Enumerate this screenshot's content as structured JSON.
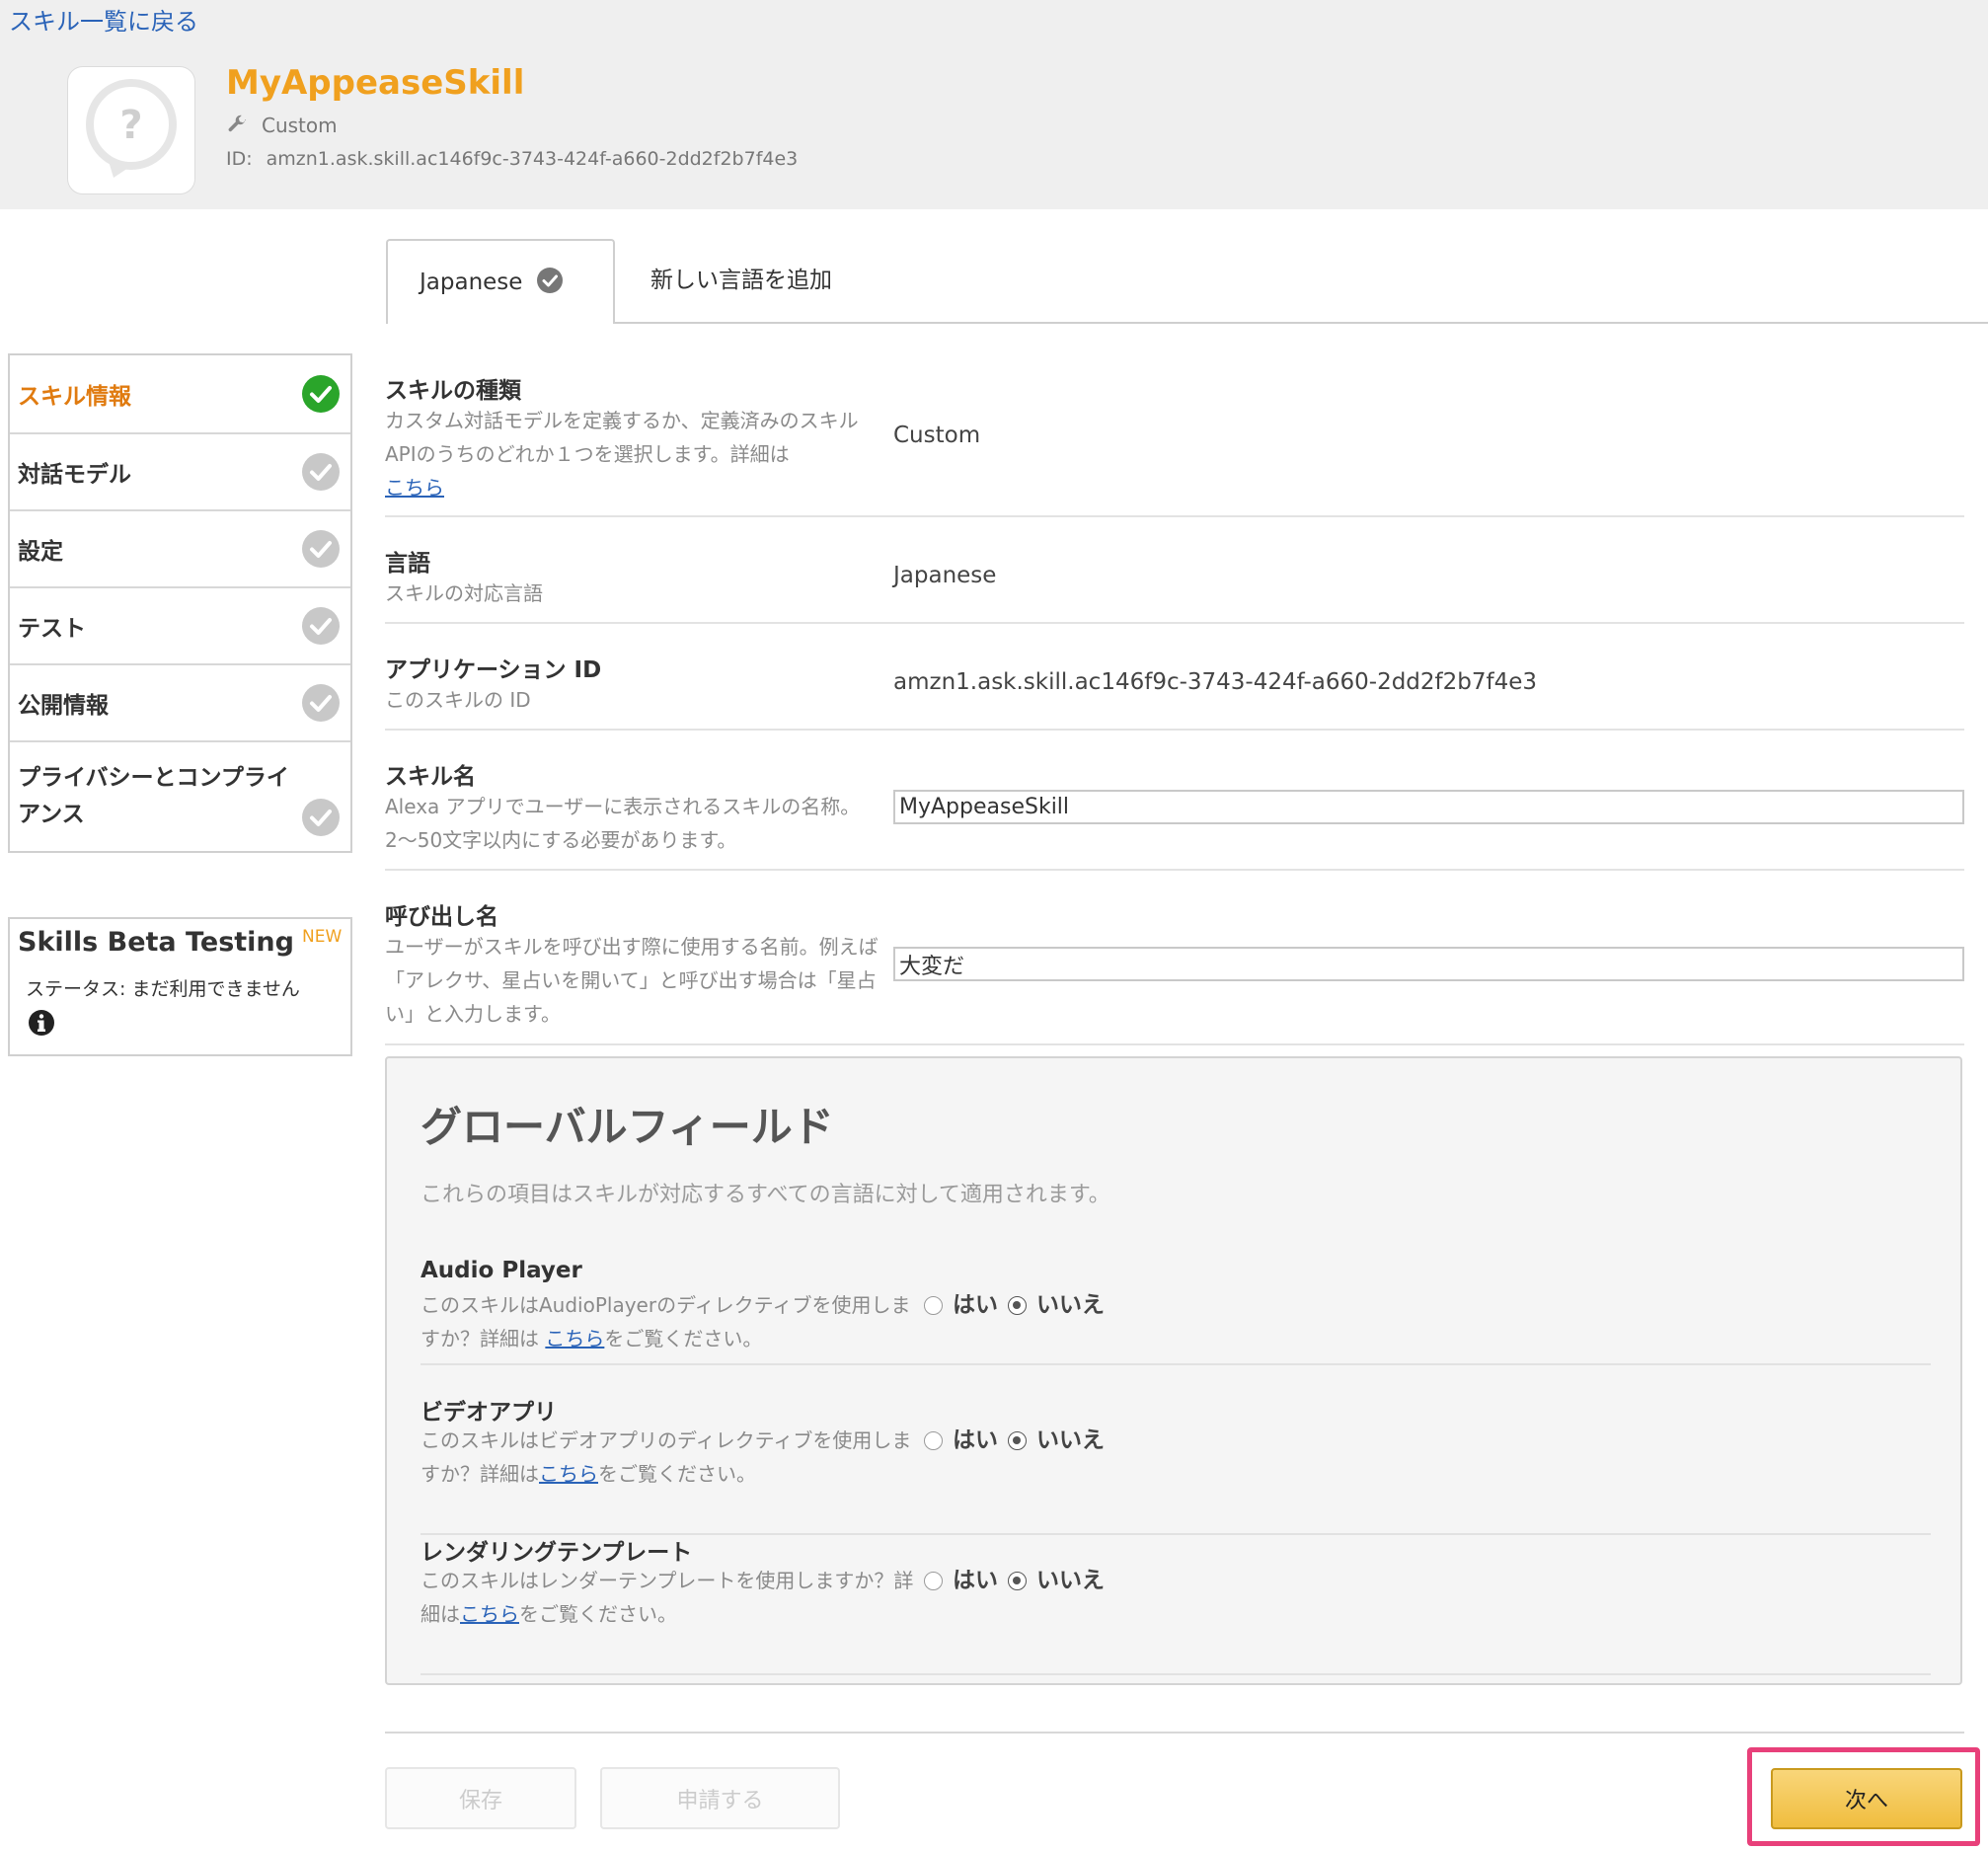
{
  "header": {
    "back_link": "スキル一覧に戻る",
    "skill_name": "MyAppeaseSkill",
    "skill_type": "Custom",
    "id_label": "ID:",
    "skill_id": "amzn1.ask.skill.ac146f9c-3743-424f-a660-2dd2f2b7f4e3"
  },
  "tabs": {
    "active": "Japanese",
    "add_language": "新しい言語を追加"
  },
  "sidebar": {
    "items": [
      {
        "label": "スキル情報",
        "active": true
      },
      {
        "label": "対話モデル",
        "active": false
      },
      {
        "label": "設定",
        "active": false
      },
      {
        "label": "テスト",
        "active": false
      },
      {
        "label": "公開情報",
        "active": false
      },
      {
        "label": "プライバシーとコンプライアンス",
        "active": false
      }
    ],
    "beta": {
      "title": "Skills Beta Testing",
      "badge": "NEW",
      "status": "ステータス: まだ利用できません"
    }
  },
  "form": {
    "skill_type": {
      "title": "スキルの種類",
      "desc": "カスタム対話モデルを定義するか、定義済みのスキルAPIのうちのどれか１つを選択します。詳細は",
      "link": "こちら",
      "value": "Custom"
    },
    "language": {
      "title": "言語",
      "desc": "スキルの対応言語",
      "value": "Japanese"
    },
    "app_id": {
      "title": "アプリケーション ID",
      "desc": "このスキルの ID",
      "value": "amzn1.ask.skill.ac146f9c-3743-424f-a660-2dd2f2b7f4e3"
    },
    "skill_name": {
      "title": "スキル名",
      "desc": "Alexa アプリでユーザーに表示されるスキルの名称。2〜50文字以内にする必要があります。",
      "value": "MyAppeaseSkill"
    },
    "invocation": {
      "title": "呼び出し名",
      "desc": "ユーザーがスキルを呼び出す際に使用する名前。例えば「アレクサ、星占いを開いて」と呼び出す場合は「星占い」と入力します。",
      "value": "大変だ"
    }
  },
  "global": {
    "title": "グローバルフィールド",
    "desc": "これらの項目はスキルが対応するすべての言語に対して適用されます。",
    "yes_label": "はい",
    "no_label": "いいえ",
    "fields": [
      {
        "title": "Audio Player",
        "desc_before": "このスキルはAudioPlayerのディレクティブを使用しますか？詳細は ",
        "link": "こちら",
        "desc_after": "をご覧ください。",
        "selected": "no"
      },
      {
        "title": "ビデオアプリ",
        "desc_before": "このスキルはビデオアプリのディレクティブを使用しますか？詳細は",
        "link": "こちら",
        "desc_after": "をご覧ください。",
        "selected": "no"
      },
      {
        "title": "レンダリングテンプレート",
        "desc_before": "このスキルはレンダーテンプレートを使用しますか？詳細は",
        "link": "こちら",
        "desc_after": "をご覧ください。",
        "selected": "no"
      }
    ]
  },
  "buttons": {
    "save": "保存",
    "submit": "申請する",
    "next": "次へ"
  },
  "colors": {
    "accent_orange": "#f0a01e",
    "active_nav": "#e07b10",
    "check_green": "#2aa52a",
    "check_gray": "#c8c8c8",
    "link_blue": "#2a63b8",
    "highlight_pink": "#e8407a",
    "next_button": "#f0bd3e"
  }
}
